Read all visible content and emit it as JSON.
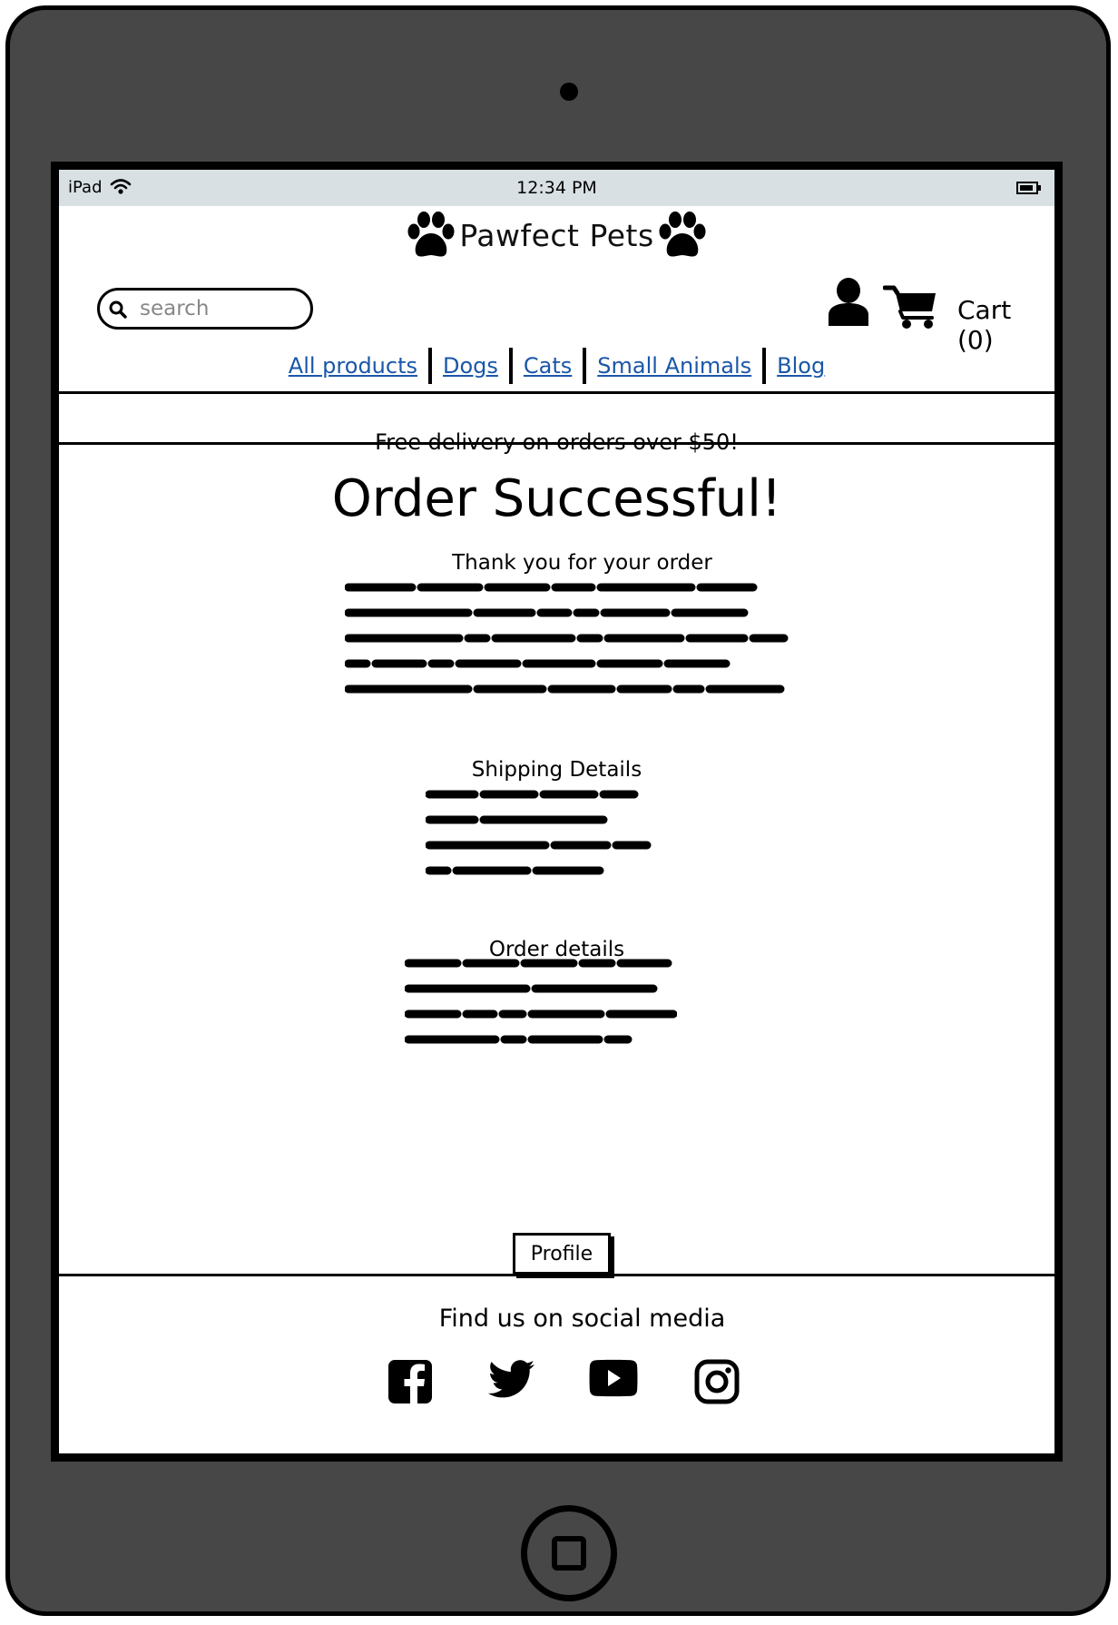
{
  "status_bar": {
    "device": "iPad",
    "time": "12:34 PM"
  },
  "header": {
    "brand": "Pawfect Pets",
    "search": {
      "placeholder": "search"
    },
    "cart_label": "Cart (0)"
  },
  "nav": {
    "items": [
      "All products",
      "Dogs",
      "Cats",
      "Small Animals",
      "Blog"
    ]
  },
  "promo": "Free delivery on orders over $50!",
  "main": {
    "title": "Order Successful!",
    "thanks_heading": "Thank you for your order",
    "shipping_heading": "Shipping Details",
    "order_heading": "Order details",
    "profile_button": "Profile"
  },
  "footer": {
    "social_heading": "Find us on social media",
    "icons": [
      "facebook-icon",
      "twitter-icon",
      "youtube-icon",
      "instagram-icon"
    ]
  },
  "colors": {
    "link": "#1a57a8",
    "status_bar": "#d9e0e4",
    "device_frame": "#474747"
  }
}
